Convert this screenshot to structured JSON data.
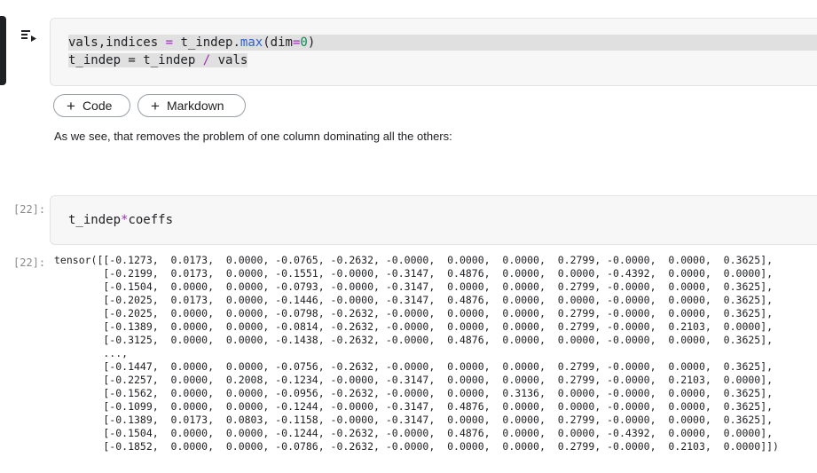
{
  "cells": [
    {
      "type": "code",
      "active": true,
      "line1": {
        "var": "vals,indices",
        "eq": "=",
        "obj": "t_indep.",
        "fn": "max",
        "open": "(",
        "arg": "dim",
        "argeq": "=",
        "num": "0",
        "close": ")"
      },
      "line2": {
        "text": "t_indep = t_indep ",
        "op": "/",
        "end": " vals"
      }
    }
  ],
  "add_buttons": {
    "code": "Code",
    "markdown": "Markdown"
  },
  "markdown_text": "As we see, that removes the problem of one column dominating all the others:",
  "cell2": {
    "prompt_in": "[22]:",
    "prompt_out": "[22]:",
    "code": {
      "a": "t_indep",
      "op": "*",
      "b": "coeffs"
    },
    "output": "tensor([[-0.1273,  0.0173,  0.0000, -0.0765, -0.2632, -0.0000,  0.0000,  0.0000,  0.2799, -0.0000,  0.0000,  0.3625],\n        [-0.2199,  0.0173,  0.0000, -0.1551, -0.0000, -0.3147,  0.4876,  0.0000,  0.0000, -0.4392,  0.0000,  0.0000],\n        [-0.1504,  0.0000,  0.0000, -0.0793, -0.0000, -0.3147,  0.0000,  0.0000,  0.2799, -0.0000,  0.0000,  0.3625],\n        [-0.2025,  0.0173,  0.0000, -0.1446, -0.0000, -0.3147,  0.4876,  0.0000,  0.0000, -0.0000,  0.0000,  0.3625],\n        [-0.2025,  0.0000,  0.0000, -0.0798, -0.2632, -0.0000,  0.0000,  0.0000,  0.2799, -0.0000,  0.0000,  0.3625],\n        [-0.1389,  0.0000,  0.0000, -0.0814, -0.2632, -0.0000,  0.0000,  0.0000,  0.2799, -0.0000,  0.2103,  0.0000],\n        [-0.3125,  0.0000,  0.0000, -0.1438, -0.2632, -0.0000,  0.4876,  0.0000,  0.0000, -0.0000,  0.0000,  0.3625],\n        ...,\n        [-0.1447,  0.0000,  0.0000, -0.0756, -0.2632, -0.0000,  0.0000,  0.0000,  0.2799, -0.0000,  0.0000,  0.3625],\n        [-0.2257,  0.0000,  0.2008, -0.1234, -0.0000, -0.3147,  0.0000,  0.0000,  0.2799, -0.0000,  0.2103,  0.0000],\n        [-0.1562,  0.0000,  0.0000, -0.0956, -0.2632, -0.0000,  0.0000,  0.3136,  0.0000, -0.0000,  0.0000,  0.3625],\n        [-0.1099,  0.0000,  0.0000, -0.1244, -0.0000, -0.3147,  0.4876,  0.0000,  0.0000, -0.0000,  0.0000,  0.3625],\n        [-0.1389,  0.0173,  0.0803, -0.1158, -0.0000, -0.3147,  0.0000,  0.0000,  0.2799, -0.0000,  0.0000,  0.3625],\n        [-0.1504,  0.0000,  0.0000, -0.1244, -0.2632, -0.0000,  0.4876,  0.0000,  0.0000, -0.4392,  0.0000,  0.0000],\n        [-0.1852,  0.0000,  0.0000, -0.0786, -0.2632, -0.0000,  0.0000,  0.0000,  0.2799, -0.0000,  0.2103,  0.0000]])"
  },
  "icons": {
    "run": "run-cell-icon"
  }
}
